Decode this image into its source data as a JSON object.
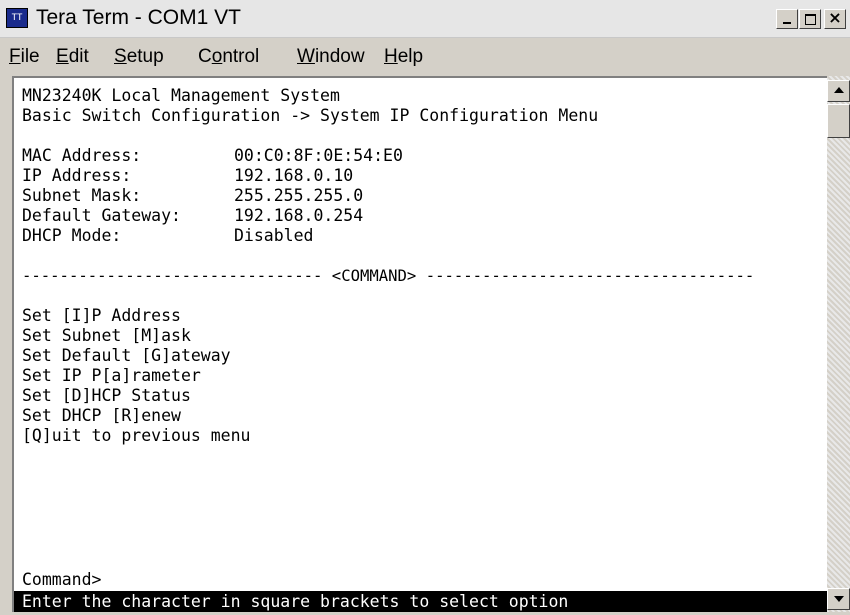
{
  "window": {
    "title": "Tera Term - COM1 VT",
    "icon": "teraterm-app-icon"
  },
  "menubar": {
    "items": [
      {
        "label": "File",
        "mnemonic": "F"
      },
      {
        "label": "Edit",
        "mnemonic": "E"
      },
      {
        "label": "Setup",
        "mnemonic": "S"
      },
      {
        "label": "Control",
        "mnemonic": "o"
      },
      {
        "label": "Window",
        "mnemonic": "W"
      },
      {
        "label": "Help",
        "mnemonic": "H"
      }
    ]
  },
  "terminal": {
    "header": [
      "MN23240K Local Management System",
      "Basic Switch Configuration -> System IP Configuration Menu"
    ],
    "fields": [
      {
        "label": "MAC Address:",
        "value": "00:C0:8F:0E:54:E0"
      },
      {
        "label": "IP Address:",
        "value": "192.168.0.10"
      },
      {
        "label": "Subnet Mask:",
        "value": "255.255.255.0"
      },
      {
        "label": "Default Gateway:",
        "value": "192.168.0.254"
      },
      {
        "label": "DHCP Mode:",
        "value": "Disabled"
      }
    ],
    "separator": "-------------------------------- <COMMAND> -----------------------------------",
    "commands": [
      "Set [I]P Address",
      "Set Subnet [M]ask",
      "Set Default [G]ateway",
      "Set IP P[a]rameter",
      "Set [D]HCP Status",
      "Set DHCP [R]enew",
      "[Q]uit to previous menu"
    ],
    "prompt": "Command>",
    "status": "Enter the character in square brackets to select option"
  },
  "colors": {
    "terminal_bg": "#ffffff",
    "terminal_fg": "#000000",
    "status_bg": "#000000",
    "status_fg": "#ffffff",
    "chrome": "#d4d0c8"
  }
}
